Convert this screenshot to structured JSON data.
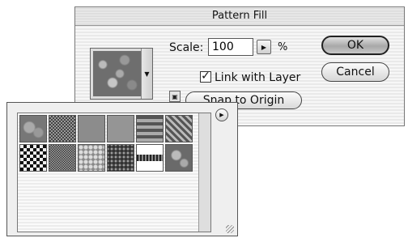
{
  "dialog": {
    "title": "Pattern Fill",
    "scale_label": "Scale:",
    "scale_value": "100",
    "scale_unit": "%",
    "link_label": "Link with Layer",
    "link_checked": true,
    "snap_label": "Snap to Origin",
    "ok_label": "OK",
    "cancel_label": "Cancel"
  },
  "icons": {
    "swatch_arrow": "▼",
    "scale_arrow": "▶",
    "picker_menu": "▶",
    "new_preset": "▣",
    "check": "✓"
  },
  "picker": {
    "patterns": [
      "pattern-1",
      "pattern-2",
      "pattern-3",
      "pattern-4",
      "pattern-5",
      "pattern-6",
      "pattern-7",
      "pattern-8",
      "pattern-9",
      "pattern-10",
      "pattern-11",
      "pattern-12"
    ]
  }
}
